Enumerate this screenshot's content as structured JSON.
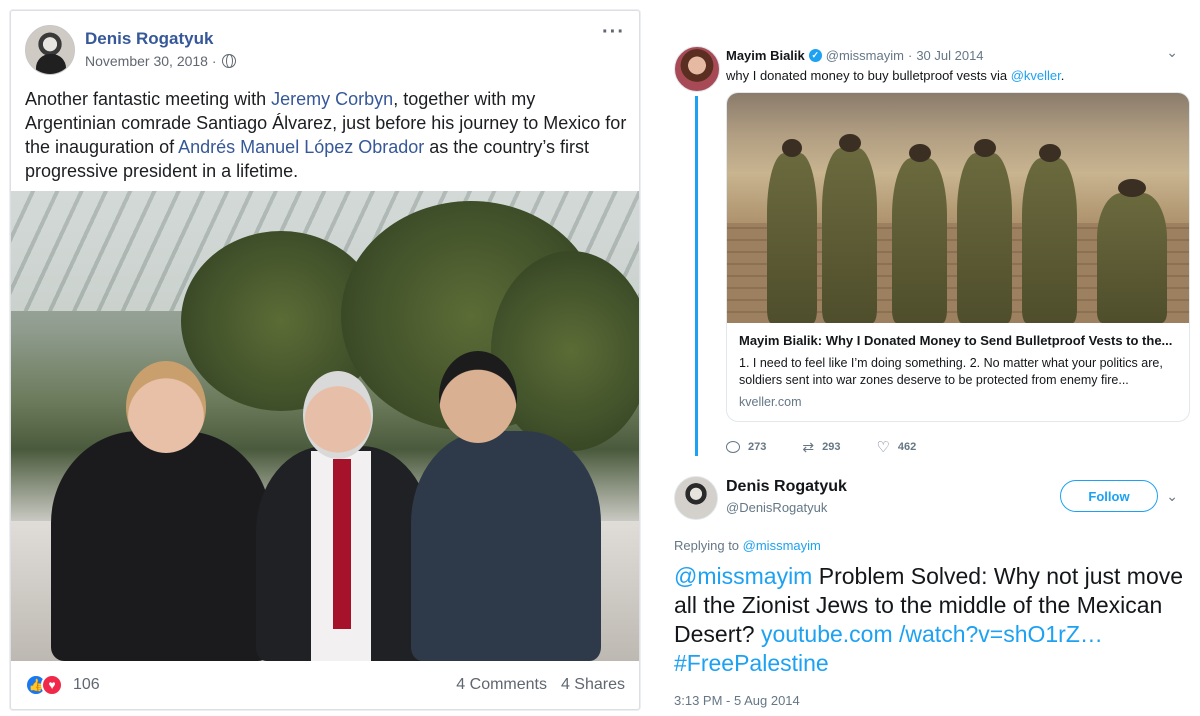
{
  "facebook_post": {
    "author": "Denis Rogatyuk",
    "date": "November 30, 2018 ·",
    "more_icon": "more-options-icon",
    "text_parts": {
      "t1": "Another fantastic meeting with ",
      "link1": "Jeremy Corbyn",
      "t2": ", together with my Argentinian comrade Santiago Álvarez, just before his journey to Mexico for the inauguration of ",
      "link2": "Andrés Manuel López Obrador",
      "t3": " as the country’s first progressive president in a lifetime."
    },
    "reaction_count": "106",
    "comments": "4 Comments",
    "shares": "4 Shares"
  },
  "tweet1": {
    "name": "Mayim Bialik",
    "handle": "@missmayim",
    "separator": "·",
    "date": "30 Jul 2014",
    "text": "why I donated money to buy bulletproof vests via ",
    "mention": "@kveller",
    "text_end": ".",
    "card": {
      "title": "Mayim Bialik: Why I Donated Money to Send Bulletproof Vests to the...",
      "description": "1. I need to feel like I’m doing something. 2. No matter what your politics are, soldiers sent into war zones deserve to be protected from enemy fire...",
      "domain": "kveller.com"
    },
    "replies": "273",
    "retweets": "293",
    "likes": "462"
  },
  "tweet2": {
    "name": "Denis Rogatyuk",
    "handle": "@DenisRogatyuk",
    "follow_label": "Follow",
    "replying_label": "Replying to ",
    "replying_to": "@missmayim",
    "mention": "@missmayim",
    "text": " Problem Solved: Why not just move all the Zionist Jews to the middle of the Mexican Desert? ",
    "link": "youtube.com /watch?v=shO1rZ…",
    "hashtag": " #FreePalestine",
    "timestamp": "3:13 PM - 5 Aug 2014"
  },
  "colors": {
    "facebook_link": "#365899",
    "twitter_blue": "#1da1f2",
    "like_blue": "#1877f2",
    "love_red": "#f0284a"
  }
}
